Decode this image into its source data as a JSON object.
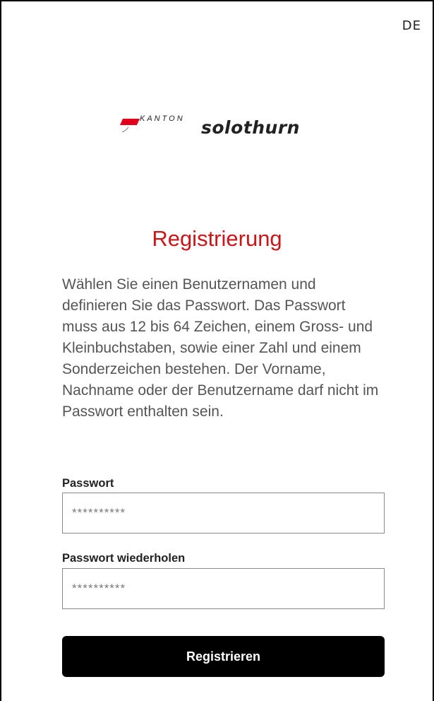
{
  "language": {
    "current": "DE"
  },
  "logo": {
    "kanton": "KANTON",
    "name": "solothurn",
    "flag_top_color": "#e2001a",
    "flag_bottom_color": "#ffffff"
  },
  "page": {
    "title": "Registrierung",
    "intro": "Wählen Sie einen Benutzernamen und definieren Sie das Passwort. Das Passwort muss aus 12 bis 64 Zeichen, einem Gross- und Kleinbuchstaben, sowie einer Zahl und einem Sonderzeichen bestehen. Der Vorname, Nachname oder der Benutzername darf nicht im Passwort enthalten sein."
  },
  "form": {
    "password": {
      "label": "Passwort",
      "placeholder": "**********",
      "value": ""
    },
    "password_repeat": {
      "label": "Passwort wiederholen",
      "placeholder": "**********",
      "value": ""
    },
    "submit_label": "Registrieren"
  },
  "colors": {
    "accent": "#cc1518",
    "button": "#000000"
  }
}
